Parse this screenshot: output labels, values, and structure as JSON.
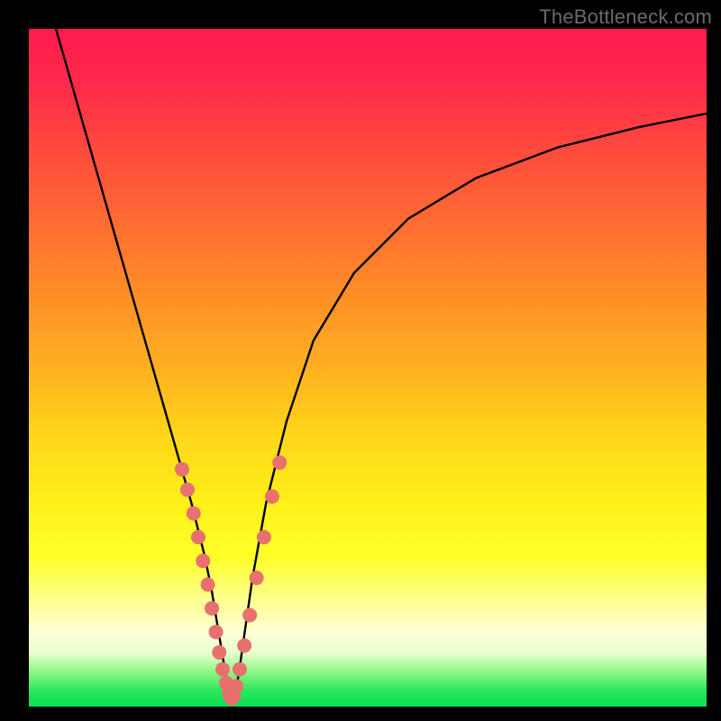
{
  "watermark": "TheBottleneck.com",
  "colors": {
    "dot": "#e8716f",
    "curve": "#000000"
  },
  "chart_data": {
    "type": "line",
    "title": "",
    "xlabel": "",
    "ylabel": "",
    "xlim": [
      0,
      100
    ],
    "ylim": [
      0,
      100
    ],
    "grid": false,
    "legend": false,
    "series": [
      {
        "name": "bottleneck-curve",
        "x": [
          4,
          6,
          8,
          10,
          12,
          14,
          16,
          18,
          20,
          22,
          24,
          26,
          27,
          28,
          29,
          29.6,
          30,
          30.4,
          31,
          32,
          33,
          35,
          38,
          42,
          48,
          56,
          66,
          78,
          90,
          100
        ],
        "y": [
          100,
          93,
          86,
          79,
          72,
          65,
          58,
          51,
          44,
          37,
          30,
          22,
          17,
          11,
          5,
          1.5,
          0.5,
          1.5,
          5,
          12,
          19,
          30,
          42,
          54,
          64,
          72,
          78,
          82.5,
          85.5,
          87.5
        ]
      }
    ],
    "markers": {
      "name": "highlight-dots",
      "x": [
        22.6,
        23.4,
        24.3,
        25.0,
        25.7,
        26.4,
        27.0,
        27.6,
        28.1,
        28.6,
        29.1,
        29.5,
        29.9,
        30.2,
        30.6,
        31.1,
        31.8,
        32.6,
        33.6,
        34.7,
        35.9,
        37.0
      ],
      "y": [
        35.0,
        32.0,
        28.5,
        25.0,
        21.5,
        18.0,
        14.5,
        11.0,
        8.0,
        5.5,
        3.5,
        2.0,
        1.2,
        1.5,
        3.0,
        5.5,
        9.0,
        13.5,
        19.0,
        25.0,
        31.0,
        36.0
      ],
      "radius": 8
    },
    "note": "Axes unlabeled in source image; values above are plot-relative 0–100 estimates from pixel positions."
  }
}
